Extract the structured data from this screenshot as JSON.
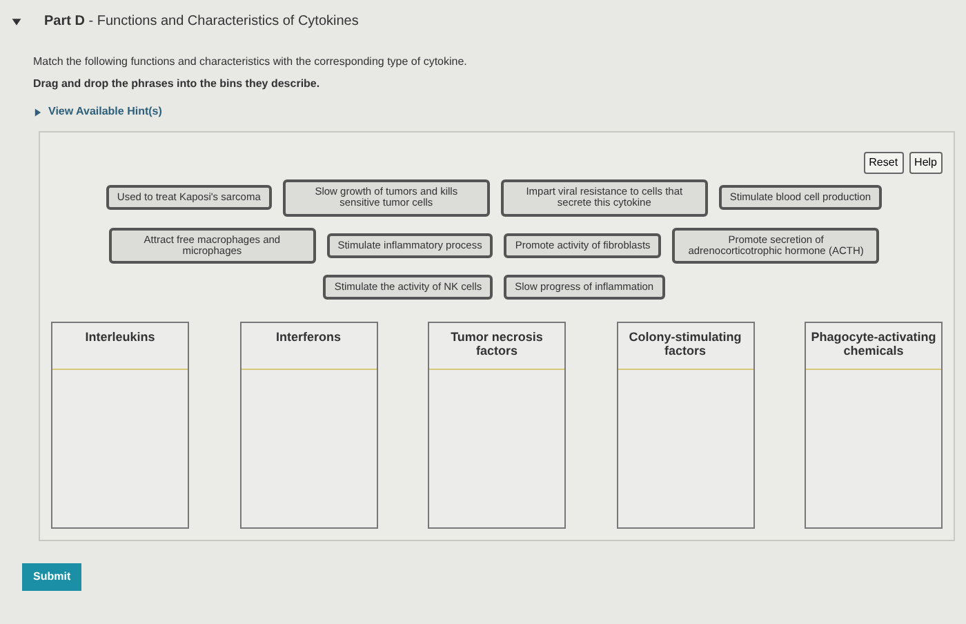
{
  "part": {
    "expanded": true,
    "label": "Part D",
    "separator": "-",
    "title": "Functions and Characteristics of Cytokines"
  },
  "instructions": [
    "Match the following functions and characteristics with the corresponding type of cytokine.",
    "Drag and drop the phrases into the bins they describe."
  ],
  "hint_link": {
    "label": "View Available Hint(s)",
    "expanded": false
  },
  "toolbar_buttons": [
    "Reset",
    "Help"
  ],
  "chip_rows": [
    [
      "Used to treat Kaposi's sarcoma",
      "Slow growth of tumors and kills sensitive tumor cells",
      "Impart viral resistance to cells that secrete this cytokine",
      "Stimulate blood cell production"
    ],
    [
      "Attract free macrophages and microphages",
      "Stimulate inflammatory process",
      "Promote activity of fibroblasts",
      "Promote secretion of adrenocorticotrophic hormone (ACTH)"
    ],
    [
      "Stimulate the activity of NK cells",
      "Slow progress of inflammation"
    ]
  ],
  "bins": [
    "Interleukins",
    "Interferons",
    "Tumor necrosis factors",
    "Colony-stimulating factors",
    "Phagocyte-activating chemicals"
  ],
  "submit": "Submit"
}
